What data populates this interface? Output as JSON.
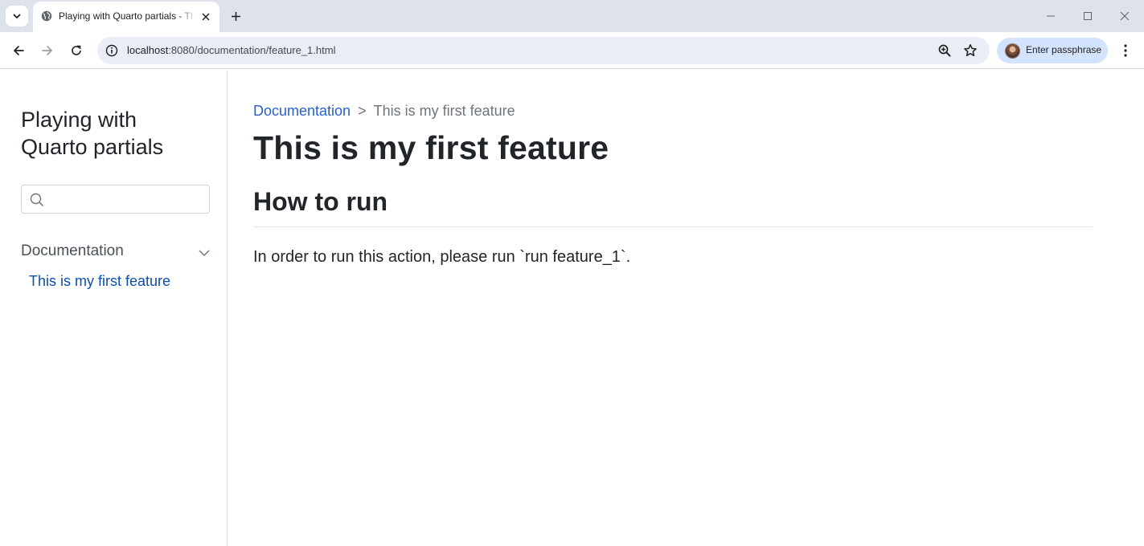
{
  "browser": {
    "tab_title": "Playing with Quarto partials - This is my first feature",
    "url_host": "localhost",
    "url_path": ":8080/documentation/feature_1.html",
    "profile_label": "Enter passphrase"
  },
  "sidebar": {
    "site_title_line1": "Playing with",
    "site_title_line2": "Quarto partials",
    "search_placeholder": "",
    "section_label": "Documentation",
    "items": [
      {
        "label": "This is my first feature"
      }
    ]
  },
  "main": {
    "breadcrumb": {
      "parent": "Documentation",
      "separator": ">",
      "current": "This is my first feature"
    },
    "title": "This is my first feature",
    "section_heading": "How to run",
    "paragraph": "In order to run this action, please run `run feature_1`."
  },
  "colors": {
    "link": "#2761c9",
    "sidebar_active": "#0d4fa6",
    "text": "#212529",
    "muted": "#6c757d"
  }
}
